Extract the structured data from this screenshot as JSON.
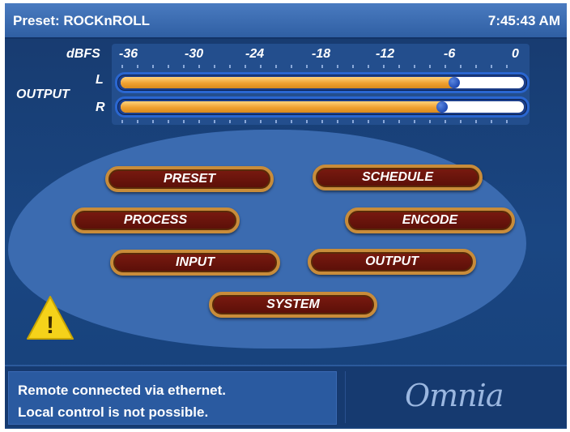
{
  "header": {
    "preset": "Preset: ROCKnROLL",
    "time": "7:45:43 AM"
  },
  "meter": {
    "scale_label": "dBFS",
    "ticks": [
      "-36",
      "-30",
      "-24",
      "-18",
      "-12",
      "-6",
      "0"
    ],
    "output_label": "OUTPUT",
    "channels": [
      {
        "name": "L",
        "level": 0.84
      },
      {
        "name": "R",
        "level": 0.81
      }
    ]
  },
  "menu": {
    "preset": "PRESET",
    "schedule": "SCHEDULE",
    "process": "PROCESS",
    "encode": "ENCODE",
    "input": "INPUT",
    "output": "OUTPUT",
    "system": "SYSTEM"
  },
  "alert": {
    "symbol": "!"
  },
  "status": {
    "line1": "Remote connected via ethernet.",
    "line2": "Local control is not possible."
  },
  "brand": {
    "logo_text": "Omnia"
  },
  "colors": {
    "titlebar": "#3a6bb2",
    "background": "#1a4682",
    "button_fill": "#6a1510",
    "button_border": "#c88c3a",
    "meter_fill": "#f0a030",
    "warning": "#f5d21a"
  }
}
